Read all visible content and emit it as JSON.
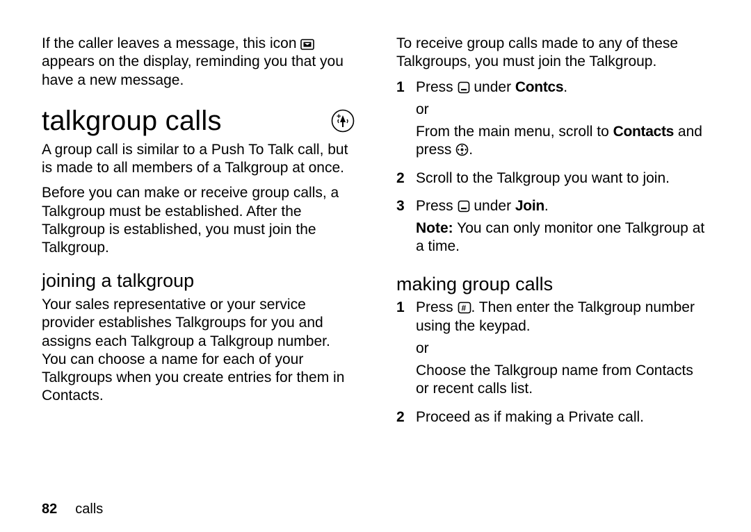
{
  "footer": {
    "page_num": "82",
    "chapter": "calls"
  },
  "left": {
    "intro_msg": {
      "pre": "If the caller leaves a message, this icon ",
      "post": " appears on the display, reminding you that you have a new message."
    },
    "section_title": "talkgroup calls",
    "para1": "A group call is similar to a Push To Talk call, but is made to all members of a Talkgroup at once.",
    "para2": "Before you can make or receive group calls, a Talkgroup must be established. After the Talkgroup is established, you must join the Talkgroup.",
    "sub1_title": "joining a talkgroup",
    "sub1_para": "Your sales representative or your service provider establishes Talkgroups for you and assigns each Talkgroup a Talkgroup number. You can choose a name for each of your Talkgroups when you create entries for them in Contacts."
  },
  "right": {
    "intro": "To receive group calls made to any of these Talkgroups, you must join the Talkgroup.",
    "steps_join": {
      "s1": {
        "num": "1",
        "line1_pre": "Press ",
        "line1_post": " under ",
        "line1_bold": "Contcs",
        "line1_end": ".",
        "or": "or",
        "line2_pre": "From the main menu, scroll to ",
        "line2_bold": "Contacts",
        "line2_mid": " and press ",
        "line2_end": "."
      },
      "s2": {
        "num": "2",
        "text": "Scroll to the Talkgroup you want to join."
      },
      "s3": {
        "num": "3",
        "line1_pre": "Press ",
        "line1_post": " under ",
        "line1_bold": "Join",
        "line1_end": ".",
        "note_label": "Note:",
        "note_text": " You can only monitor one Talkgroup at a time."
      }
    },
    "sub2_title": "making group calls",
    "steps_make": {
      "s1": {
        "num": "1",
        "line1_pre": "Press ",
        "line1_post": ". Then enter the Talkgroup number using the keypad.",
        "or": "or",
        "line2": "Choose the Talkgroup name from Contacts or recent calls list."
      },
      "s2": {
        "num": "2",
        "text": "Proceed as if making a Private call."
      }
    }
  }
}
